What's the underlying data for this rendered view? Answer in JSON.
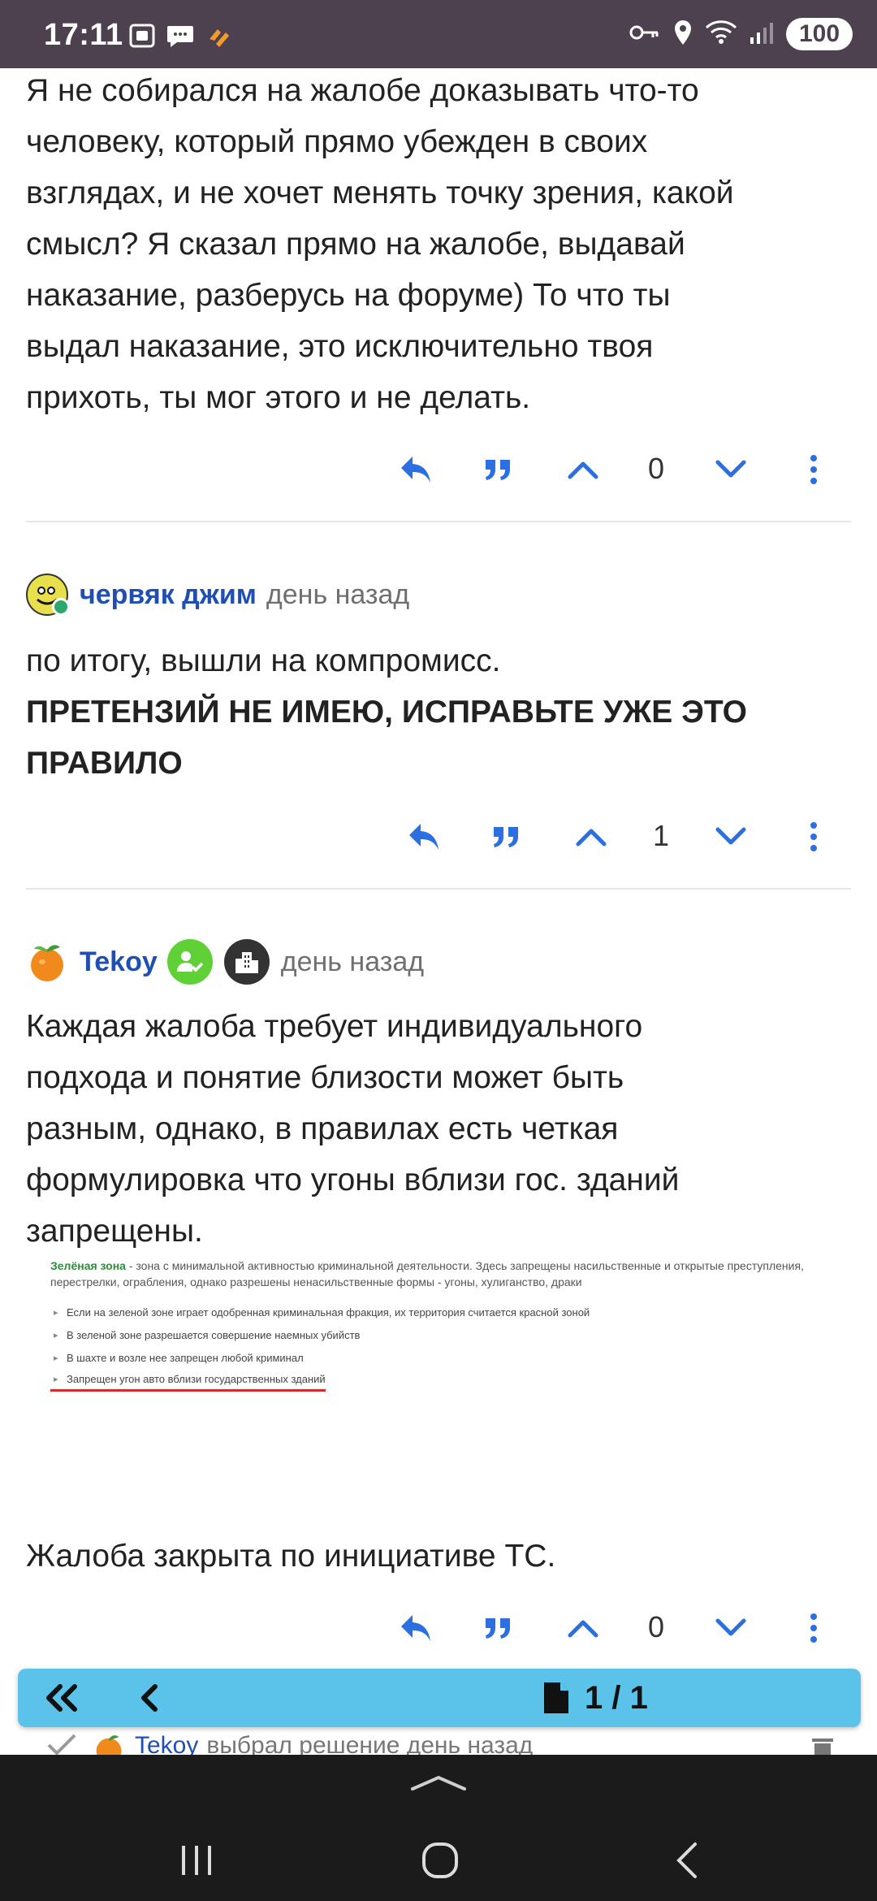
{
  "status_bar": {
    "time": "17:11",
    "battery": "100",
    "left_icons": [
      "screenshot-icon",
      "messages-icon",
      "app-icon"
    ],
    "right_icons": [
      "key-icon",
      "location-icon",
      "wifi-icon",
      "signal-icon"
    ]
  },
  "posts": [
    {
      "id": "post-1",
      "lines": [
        "Я не собирался на жалобе доказывать что-то",
        "человеку, который прямо убежден в своих",
        "взглядах, и не хочет менять точку зрения, какой",
        "смысл? Я сказал прямо на жалобе, выдавай",
        "наказание, разберусь на форуме) То что ты",
        "выдал наказание, это исключительно твоя",
        "прихоть, ты мог этого и не делать."
      ],
      "votes": "0"
    },
    {
      "id": "post-2",
      "author": "червяк джим",
      "time": "день назад",
      "lines": [
        "по итогу, вышли на компромисс."
      ],
      "bold_lines": [
        "ПРЕТЕНЗИЙ НЕ ИМЕЮ, ИСПРАВЬТЕ УЖЕ ЭТО",
        "ПРАВИЛО"
      ],
      "votes": "1"
    },
    {
      "id": "post-3",
      "author": "Tekoy",
      "time": "день назад",
      "lines": [
        "Каждая жалоба требует индивидуального",
        "подхода и понятие близости может быть",
        "разным, однако, в правилах есть четкая",
        "формулировка что угоны вблизи гос. зданий",
        "запрещены."
      ],
      "closing": "Жалоба закрыта по инициативе ТС.",
      "votes": "0"
    }
  ],
  "rules_image": {
    "zone_name": "Зелёная зона",
    "intro": " - зона с минимальной активностью криминальной деятельности. Здесь запрещены насильственные и открытые преступления, перестрелки, ограбления, однако разрешены ненасильственные формы - угоны, хулиганство, драки",
    "items": [
      "Если на зеленой зоне играет одобренная криминальная фракция, их территория считается красной зоной",
      "В зеленой зоне разрешается совершение наемных убийств",
      "В шахте и возле нее запрещен любой криминал",
      "Запрещен угон авто вблизи государственных зданий"
    ]
  },
  "pagination": {
    "counter": "1 / 1"
  },
  "event": {
    "author": "Tekoy",
    "text": "выбрал решение день назад"
  },
  "colors": {
    "accent": "#2b6fe0",
    "author": "#1f4fb3",
    "status_bar": "#4d4150",
    "pagination": "#5bc3ea",
    "nav_bar": "#1b1b1b",
    "highlight_underline": "#d12d2d",
    "green_zone": "#2e8b3a"
  }
}
